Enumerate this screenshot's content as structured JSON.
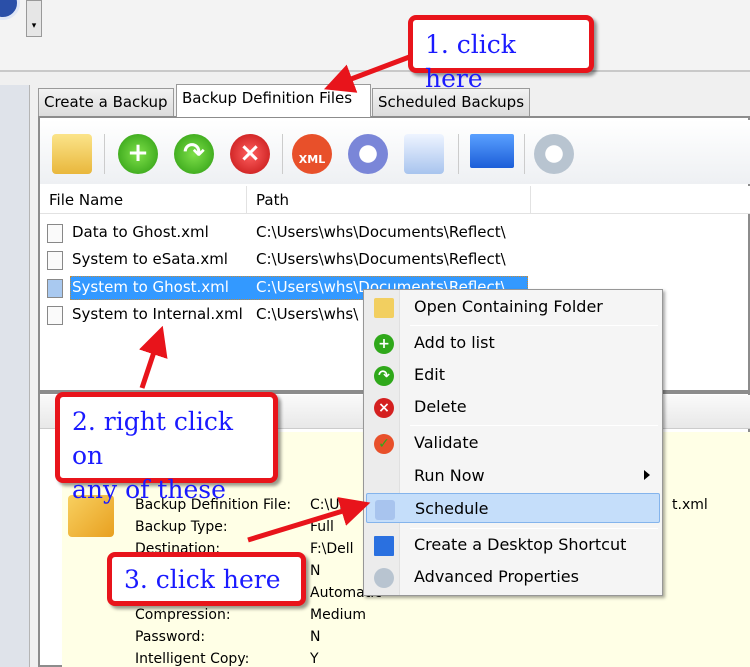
{
  "tabs": [
    {
      "label": "Create a Backup"
    },
    {
      "label": "Backup Definition Files"
    },
    {
      "label": "Scheduled Backups"
    }
  ],
  "toolbar": {
    "icons": [
      "folder-open-icon",
      "add-icon",
      "edit-icon",
      "delete-icon",
      "validate-xml-icon",
      "gear-icon",
      "schedule-icon",
      "desktop-shortcut-icon",
      "advanced-properties-icon"
    ]
  },
  "list": {
    "columns": [
      "File Name",
      "Path"
    ],
    "rows": [
      {
        "name": "Data to Ghost.xml",
        "path": "C:\\Users\\whs\\Documents\\Reflect\\"
      },
      {
        "name": "System to eSata.xml",
        "path": "C:\\Users\\whs\\Documents\\Reflect\\"
      },
      {
        "name": "System to Ghost.xml",
        "path": "C:\\Users\\whs\\Documents\\Reflect\\",
        "selected": true
      },
      {
        "name": "System to Internal.xml",
        "path": "C:\\Users\\whs\\"
      }
    ]
  },
  "details": {
    "labels": [
      "Backup Definition File:",
      "Backup Type:",
      "Destination:",
      "",
      "",
      "Compression:",
      "Password:",
      "Intelligent Copy:"
    ],
    "values": [
      "C:\\User",
      "Full",
      "F:\\Dell",
      "N",
      "Automatic",
      "Medium",
      "N",
      "Y"
    ],
    "tail": "t.xml"
  },
  "context_menu": {
    "items": [
      {
        "label": "Open Containing Folder",
        "icon": "folder-icon"
      },
      {
        "label": "Add to list",
        "icon": "add-icon"
      },
      {
        "label": "Edit",
        "icon": "edit-icon"
      },
      {
        "label": "Delete",
        "icon": "delete-icon"
      },
      {
        "label": "Validate",
        "icon": "validate-icon"
      },
      {
        "label": "Run Now",
        "icon": "",
        "submenu": true
      },
      {
        "label": "Schedule",
        "icon": "schedule-icon",
        "highlighted": true
      },
      {
        "label": "Create a Desktop Shortcut",
        "icon": "desktop-shortcut-icon"
      },
      {
        "label": "Advanced Properties",
        "icon": "advanced-properties-icon"
      }
    ]
  },
  "callouts": {
    "step1": "1. click here",
    "step2_line1": "2. right click on",
    "step2_line2": "any of these",
    "step3": "3. click here"
  },
  "colors": {
    "selection": "#3399ff",
    "callout_border": "#e8141b",
    "callout_text": "#1a1aff",
    "menu_highlight": "#c5defa"
  }
}
